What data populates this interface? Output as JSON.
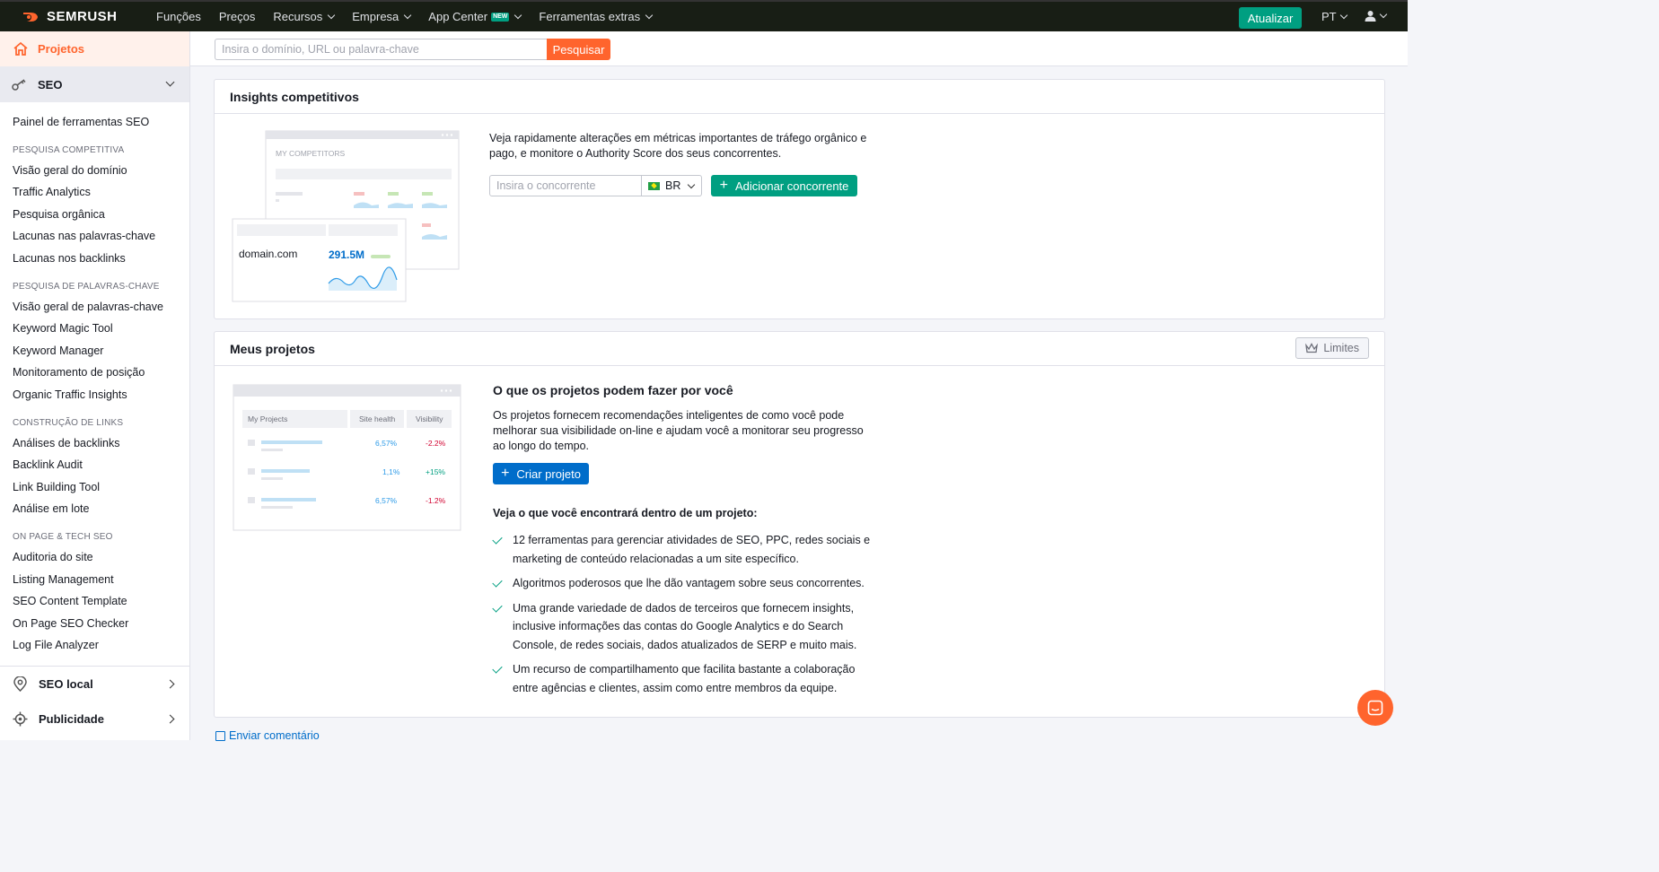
{
  "topbar": {
    "logo": "SEMRUSH",
    "nav": [
      {
        "label": "Funções",
        "dropdown": false
      },
      {
        "label": "Preços",
        "dropdown": false
      },
      {
        "label": "Recursos",
        "dropdown": true
      },
      {
        "label": "Empresa",
        "dropdown": true
      },
      {
        "label": "App Center",
        "dropdown": true,
        "badge": "NEW"
      },
      {
        "label": "Ferramentas extras",
        "dropdown": true
      }
    ],
    "upgrade_label": "Atualizar",
    "language": "PT"
  },
  "sidebar": {
    "projects_label": "Projetos",
    "seo_label": "SEO",
    "dashboard_label": "Painel de ferramentas SEO",
    "groups": [
      {
        "heading": "PESQUISA COMPETITIVA",
        "items": [
          "Visão geral do domínio",
          "Traffic Analytics",
          "Pesquisa orgânica",
          "Lacunas nas palavras-chave",
          "Lacunas nos backlinks"
        ]
      },
      {
        "heading": "PESQUISA DE PALAVRAS-CHAVE",
        "items": [
          "Visão geral de palavras-chave",
          "Keyword Magic Tool",
          "Keyword Manager",
          "Monitoramento de posição",
          "Organic Traffic Insights"
        ]
      },
      {
        "heading": "CONSTRUÇÃO DE LINKS",
        "items": [
          "Análises de backlinks",
          "Backlink Audit",
          "Link Building Tool",
          "Análise em lote"
        ]
      },
      {
        "heading": "ON PAGE & TECH SEO",
        "items": [
          "Auditoria do site",
          "Listing Management",
          "SEO Content Template",
          "On Page SEO Checker",
          "Log File Analyzer"
        ]
      }
    ],
    "local_seo_label": "SEO local",
    "ads_label": "Publicidade"
  },
  "search": {
    "placeholder": "Insira o domínio, URL ou palavra-chave",
    "button_label": "Pesquisar"
  },
  "insights": {
    "title": "Insights competitivos",
    "description": "Veja rapidamente alterações em métricas importantes de tráfego orgânico e pago, e monitore o Authority Score dos seus concorrentes.",
    "competitor_placeholder": "Insira o concorrente",
    "database": "BR",
    "add_label": "Adicionar concorrente",
    "illustration": {
      "header": "MY COMPETITORS",
      "domain": "domain.com",
      "value": "291.5M"
    }
  },
  "projects": {
    "title": "Meus projetos",
    "limits_label": "Limites",
    "heading": "O que os projetos podem fazer por você",
    "description": "Os projetos fornecem recomendações inteligentes de como você pode melhorar sua visibilidade on-line e ajudam você a monitorar seu progresso ao longo do tempo.",
    "create_label": "Criar projeto",
    "sub_heading": "Veja o que você encontrará dentro de um projeto:",
    "features": [
      "12 ferramentas para gerenciar atividades de SEO, PPC, redes sociais e marketing de conteúdo relacionadas a um site específico.",
      "Algoritmos poderosos que lhe dão vantagem sobre seus concorrentes.",
      "Uma grande variedade de dados de terceiros que fornecem insights, inclusive informações das contas do Google Analytics e do Search Console, de redes sociais, dados atualizados de SERP e muito mais.",
      "Um recurso de compartilhamento que facilita bastante a colaboração entre agências e clientes, assim como entre membros da equipe."
    ],
    "illustration": {
      "headers": [
        "My Projects",
        "Site health",
        "Visibility"
      ],
      "rows": [
        {
          "health": "6,57%",
          "visibility": "-2.2%"
        },
        {
          "health": "1,1%",
          "visibility": "+15%"
        },
        {
          "health": "6,57%",
          "visibility": "-1.2%"
        }
      ]
    }
  },
  "footer": {
    "feedback_label": "Enviar comentário"
  },
  "colors": {
    "brand": "#ff642d",
    "green": "#009f81",
    "blue": "#006dca",
    "dark": "#181e15"
  }
}
